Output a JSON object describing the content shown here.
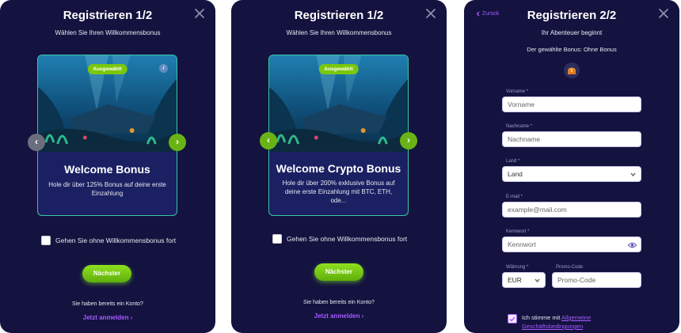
{
  "colors": {
    "panel_bg": "#14123f",
    "accent_green": "#7ac70c",
    "link_purple": "#a55cff",
    "card_border": "#38c7a4"
  },
  "step1": {
    "title": "Registrieren 1/2",
    "subtitle": "Wählen Sie Ihren Willkommensbonus",
    "card": {
      "badge": "Ausgewählt",
      "title": "Welcome Bonus",
      "description": "Hole dir über 125% Bonus auf deine erste Einzahlung"
    },
    "checkbox_label": "Gehen Sie ohne Willkommensbonus fort",
    "next_label": "Nächster",
    "have_account": "Sie haben bereits ein Konto?",
    "login_label": "Jetzt anmelden ›"
  },
  "step1b": {
    "title": "Registrieren 1/2",
    "subtitle": "Wählen Sie Ihren Willkommensbonus",
    "card": {
      "badge": "Ausgewählt",
      "title": "Welcome Crypto Bonus",
      "description": "Hole dir über 200% exklusive Bonus auf deine erste Einzahlung mit BTC, ETH, ode..."
    },
    "checkbox_label": "Gehen Sie ohne Willkommensbonus fort",
    "next_label": "Nächster",
    "have_account": "Sie haben bereits ein Konto?",
    "login_label": "Jetzt anmelden ›"
  },
  "step2": {
    "back_label": "Zurück",
    "title": "Registrieren 2/2",
    "subtitle": "Ihr Abenteuer beginnt",
    "bonus_line": "Der gewählte Bonus: Ohne Bonus",
    "fields": {
      "firstname": {
        "label": "Vorname *",
        "placeholder": "Vorname"
      },
      "lastname": {
        "label": "Nachname *",
        "placeholder": "Nachname"
      },
      "country": {
        "label": "Land *",
        "value": "Land"
      },
      "email": {
        "label": "E-mail *",
        "placeholder": "example@mail.com"
      },
      "password": {
        "label": "Kennwort *",
        "placeholder": "Kennwort"
      },
      "currency": {
        "label": "Währung *",
        "value": "EUR"
      },
      "promo": {
        "label": "Promo-Code",
        "placeholder": "Promo-Code"
      }
    },
    "agree_prefix": "Ich stimme mit ",
    "agree_link": "Allgemeine Geschäftsbedingungen"
  },
  "icons": [
    "close-icon",
    "chevron-left-icon",
    "chevron-right-icon",
    "info-icon",
    "chevron-down-icon",
    "eye-icon",
    "treasure-icon",
    "check-icon"
  ]
}
